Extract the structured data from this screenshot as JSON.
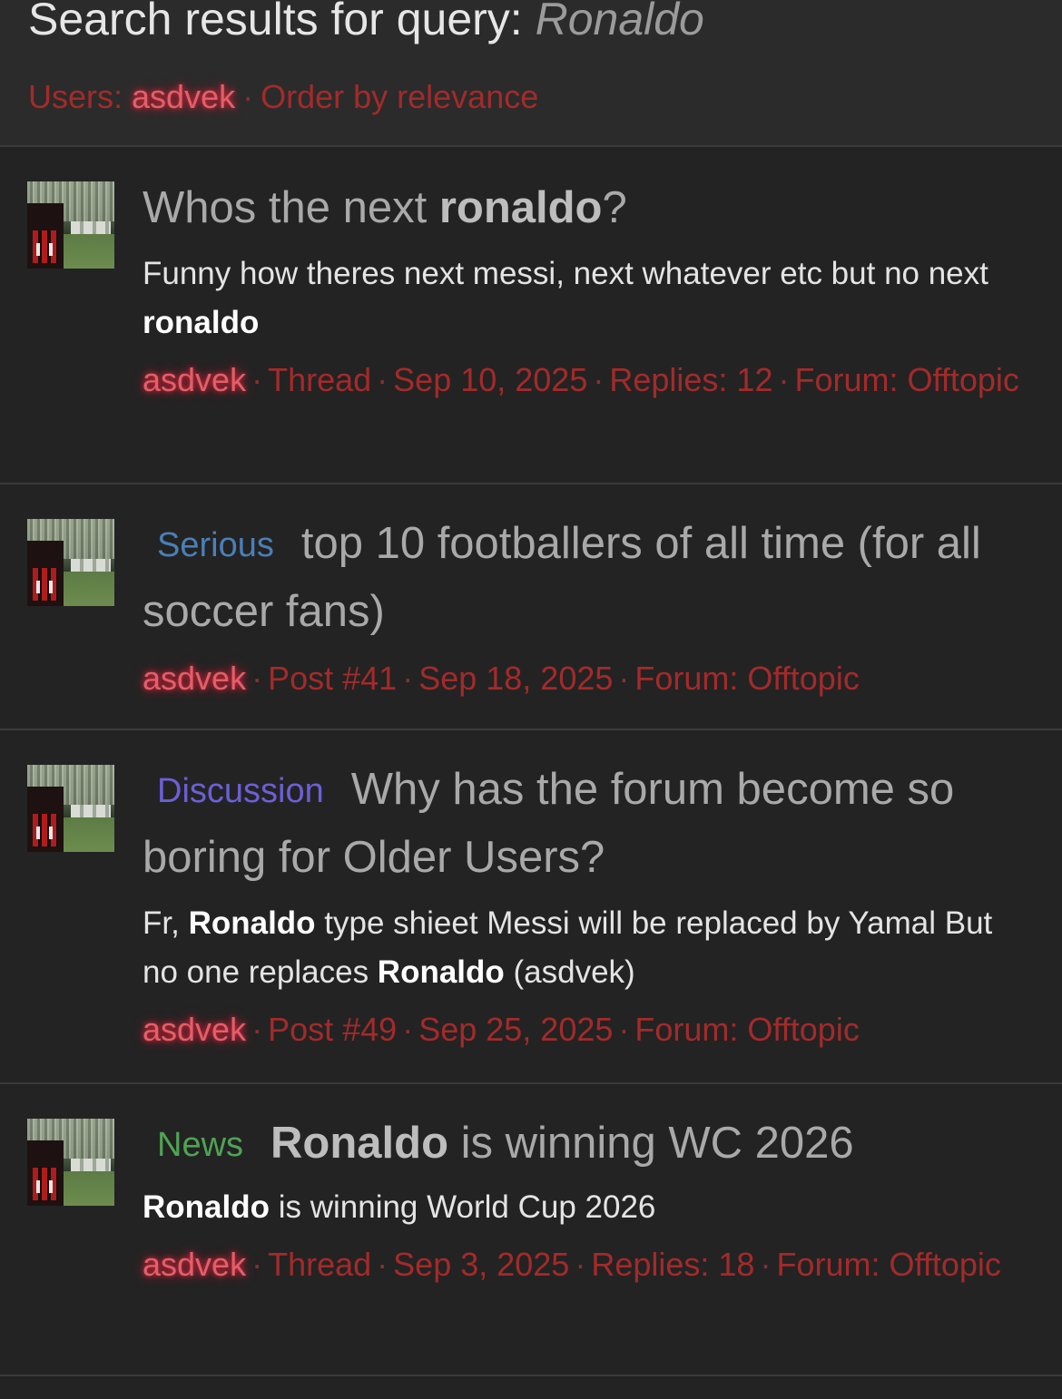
{
  "header": {
    "title_prefix": "Search results for query:",
    "query": "Ronaldo",
    "users_label": "Users:",
    "user": "asdvek",
    "order": "Order by relevance"
  },
  "results": [
    {
      "title_plain": "Whos the next ",
      "title_bold": "ronaldo",
      "title_after": "?",
      "snippet_parts": [
        "Funny how theres next messi, next whatever etc but no next ",
        "ronaldo"
      ],
      "author": "asdvek",
      "type": "Thread",
      "date": "Sep 10, 2025",
      "replies": "Replies: 12",
      "forum_label": "Forum:",
      "forum": "Offtopic"
    },
    {
      "tag": "Serious",
      "tag_color": "#4a7fb8",
      "title": "top 10 footballers of all time (for all soccer fans)",
      "author": "asdvek",
      "type": "Post #41",
      "date": "Sep 18, 2025",
      "forum_label": "Forum:",
      "forum": "Offtopic"
    },
    {
      "tag": "Discussion",
      "tag_color": "#6c5fd6",
      "title": "Why has the forum become so boring for Older Users?",
      "snippet_parts": [
        "Fr, ",
        "Ronaldo",
        " type shieet Messi will be replaced by Yamal But no one replaces ",
        "Ronaldo",
        " (asdvek)"
      ],
      "author": "asdvek",
      "type": "Post #49",
      "date": "Sep 25, 2025",
      "forum_label": "Forum:",
      "forum": "Offtopic"
    },
    {
      "tag": "News",
      "tag_color": "#4fa354",
      "title_bold": "Ronaldo",
      "title_after": " is winning WC 2026",
      "snippet_parts": [
        "Ronaldo",
        " is winning World Cup 2026"
      ],
      "author": "asdvek",
      "type": "Thread",
      "date": "Sep 3, 2025",
      "replies": "Replies: 18",
      "forum_label": "Forum:",
      "forum": "Offtopic"
    }
  ],
  "separator": "·"
}
